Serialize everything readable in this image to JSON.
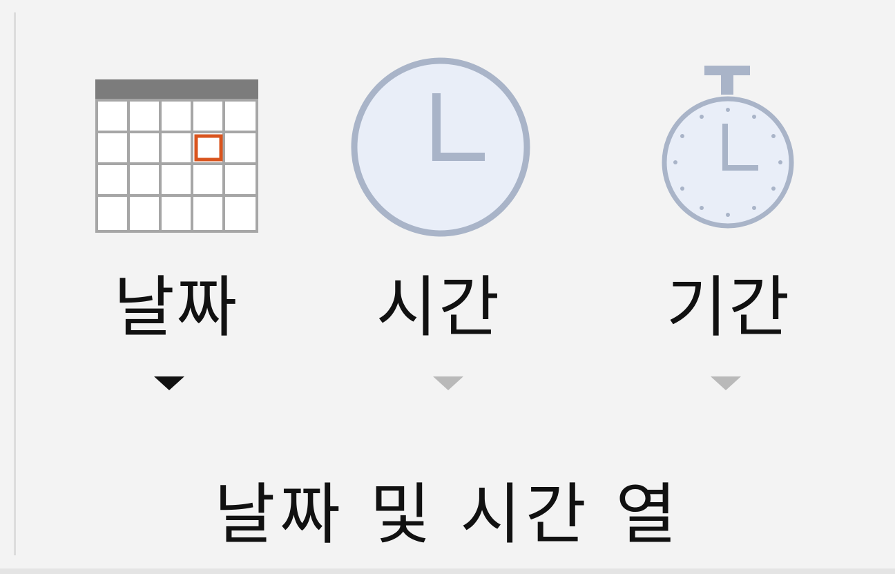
{
  "group": {
    "label": "날짜 및 시간 열"
  },
  "buttons": [
    {
      "label": "날짜",
      "icon": "calendar-icon",
      "enabled": true
    },
    {
      "label": "시간",
      "icon": "clock-icon",
      "enabled": false
    },
    {
      "label": "기간",
      "icon": "stopwatch-icon",
      "enabled": false
    }
  ],
  "colors": {
    "calendar_highlight": "#d9541e",
    "icon_stroke": "#a9b4c8",
    "icon_fill": "#e9eef8",
    "arrow_enabled": "#111111",
    "arrow_disabled": "#b9b9b9",
    "background": "#f3f3f3"
  }
}
